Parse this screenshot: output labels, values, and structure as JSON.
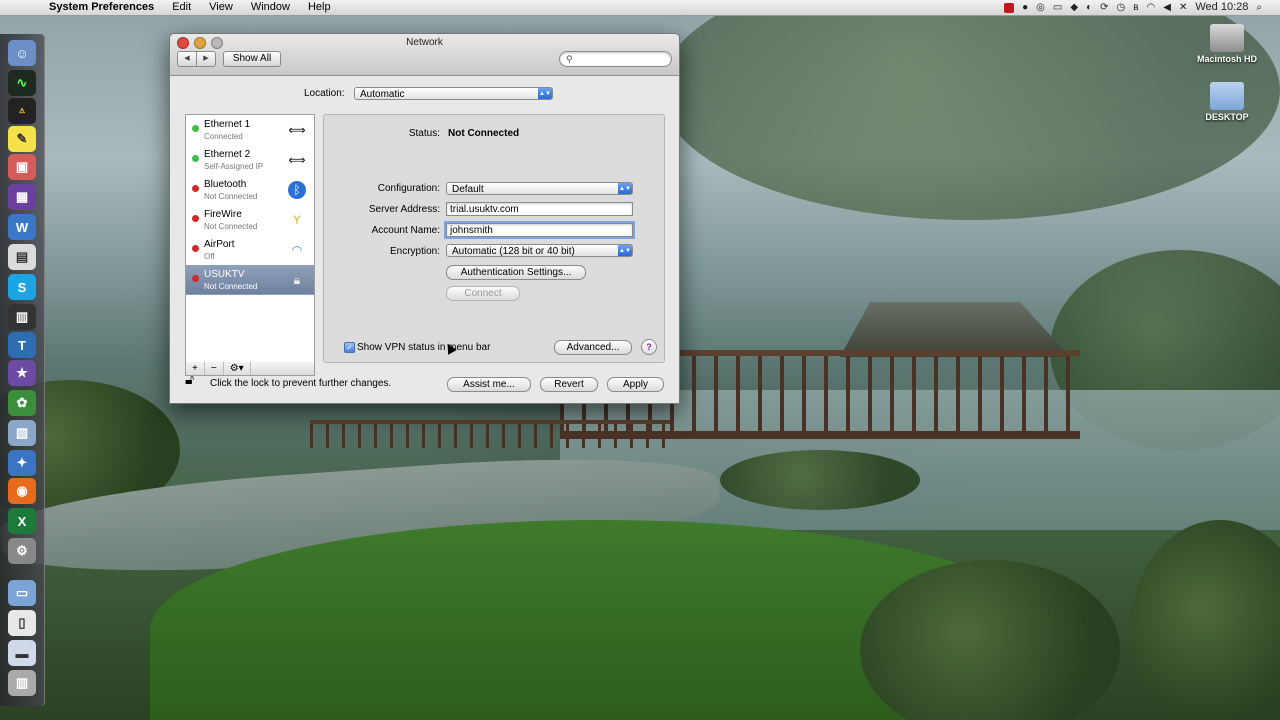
{
  "menubar": {
    "app_name": "System Preferences",
    "menus": [
      "Edit",
      "View",
      "Window",
      "Help"
    ],
    "clock": "Wed 10:28"
  },
  "desktop": {
    "icons": [
      {
        "label": "Macintosh HD"
      },
      {
        "label": "DESKTOP"
      }
    ]
  },
  "window": {
    "title": "Network",
    "show_all_label": "Show All",
    "search_placeholder": "",
    "location_label": "Location:",
    "location_value": "Automatic",
    "services": [
      {
        "name": "Ethernet 1",
        "status": "Connected",
        "dot_color": "#3fbf3f",
        "icon": "ethernet-icon"
      },
      {
        "name": "Ethernet 2",
        "status": "Self-Assigned IP",
        "dot_color": "#3fbf3f",
        "icon": "ethernet-icon"
      },
      {
        "name": "Bluetooth",
        "status": "Not Connected",
        "dot_color": "#d32828",
        "icon": "bluetooth-icon"
      },
      {
        "name": "FireWire",
        "status": "Not Connected",
        "dot_color": "#d32828",
        "icon": "firewire-icon"
      },
      {
        "name": "AirPort",
        "status": "Off",
        "dot_color": "#d32828",
        "icon": "wifi-icon"
      },
      {
        "name": "USUKTV",
        "status": "Not Connected",
        "dot_color": "#d32828",
        "icon": "vpn-lock-icon",
        "selected": true
      }
    ],
    "sidebar_footer": {
      "add": "+",
      "remove": "−",
      "action": "⚙▾"
    },
    "detail": {
      "status_label": "Status:",
      "status_value": "Not Connected",
      "configuration_label": "Configuration:",
      "configuration_value": "Default",
      "server_label": "Server Address:",
      "server_value": "trial.usuktv.com",
      "account_label": "Account Name:",
      "account_value": "johnsmith",
      "encryption_label": "Encryption:",
      "encryption_value": "Automatic (128 bit or 40 bit)",
      "auth_button": "Authentication Settings...",
      "connect_button": "Connect",
      "show_vpn_label": "Show VPN status in menu bar",
      "show_vpn_checked": true,
      "advanced_button": "Advanced...",
      "help_button": "?"
    },
    "lock_text": "Click the lock to prevent further changes.",
    "assist_button": "Assist me...",
    "revert_button": "Revert",
    "apply_button": "Apply"
  },
  "colors": {
    "selection": "#7b8dab",
    "accent_blue": "#2b67d8"
  }
}
